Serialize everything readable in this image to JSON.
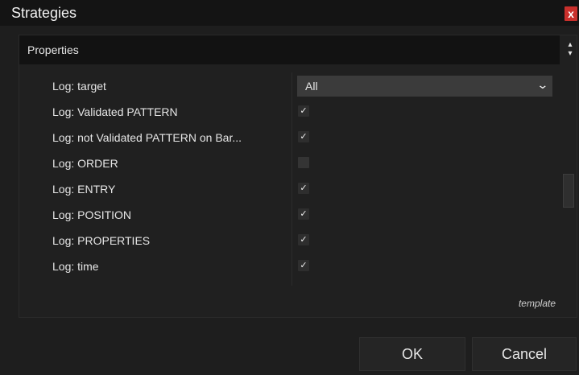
{
  "window": {
    "title": "Strategies",
    "close_label": "x"
  },
  "section": {
    "title": "Properties",
    "updown_up": "▴",
    "updown_down": "▾"
  },
  "properties": [
    {
      "label": "Log: target",
      "type": "dropdown",
      "value": "All"
    },
    {
      "label": "Log: Validated PATTERN",
      "type": "checkbox",
      "checked": true
    },
    {
      "label": "Log: not Validated PATTERN on Bar...",
      "type": "checkbox",
      "checked": true
    },
    {
      "label": "Log: ORDER",
      "type": "checkbox",
      "checked": false
    },
    {
      "label": "Log: ENTRY",
      "type": "checkbox",
      "checked": true
    },
    {
      "label": "Log: POSITION",
      "type": "checkbox",
      "checked": true
    },
    {
      "label": "Log: PROPERTIES",
      "type": "checkbox",
      "checked": true
    },
    {
      "label": "Log: time",
      "type": "checkbox",
      "checked": true
    }
  ],
  "template_link": "template",
  "buttons": {
    "ok": "OK",
    "cancel": "Cancel"
  },
  "icons": {
    "checkmark": "✓",
    "chevron": "⌄",
    "close": "close-icon"
  },
  "colors": {
    "close_red": "#c9302c",
    "background": "#1e1e1e",
    "header": "#121212"
  }
}
